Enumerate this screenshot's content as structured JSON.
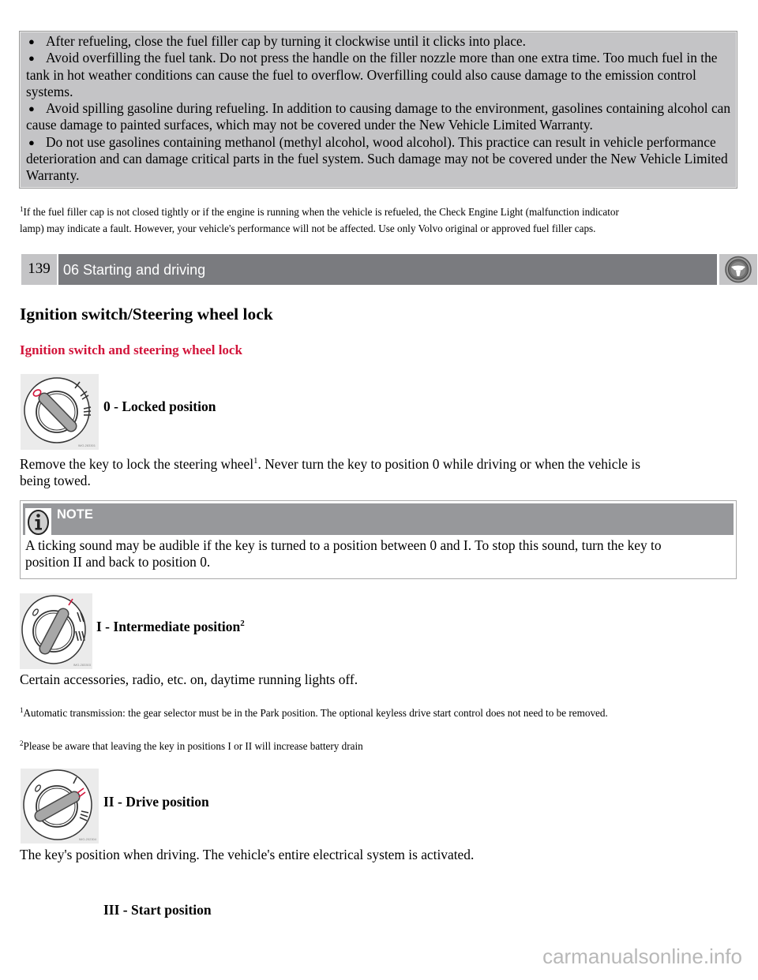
{
  "warning_box": {
    "bullets": [
      "After refueling, close the fuel filler cap by turning it clockwise until it clicks into place.",
      "Avoid overfilling the fuel tank. Do not press the handle on the filler nozzle more than one extra time. Too much fuel in the tank in hot weather conditions can cause the fuel to overflow. Overfilling could also cause damage to the emission control systems.",
      "Avoid spilling gasoline during refueling. In addition to causing damage to the environment, gasolines containing alcohol can cause damage to painted surfaces, which may not be covered under the New Vehicle Limited Warranty.",
      "Do not use gasolines containing methanol (methyl alcohol, wood alcohol). This practice can result in vehicle performance deterioration and can damage critical parts in the fuel system. Such damage may not be covered under the New Vehicle Limited Warranty."
    ]
  },
  "footnote_top": {
    "marker": "1",
    "line1": "If the fuel filler cap is not closed tightly or if the engine is running when the vehicle is refueled, the Check Engine Light (malfunction indicator",
    "line2": "lamp) may indicate a fault. However, your vehicle's performance will not be affected. Use only Volvo original or approved fuel filler caps."
  },
  "chapter": {
    "page_number": "139",
    "title": "06 Starting and driving",
    "icon": "steering-wheel-icon"
  },
  "page_title": "Ignition switch/Steering wheel lock",
  "section_title": "Ignition switch and steering wheel lock",
  "colors": {
    "section_title": "#d2143a",
    "chapter_bar": "#7a7b7f",
    "warning_bg": "#c4c4c6",
    "note_header": "#97989b"
  },
  "positions": [
    {
      "label": "0 - Locked position",
      "image_caption": "IMG-283301",
      "text_before_sup": "Remove the key to lock the steering wheel",
      "sup": "1",
      "text_after_sup_line1": ". Never turn the key to position 0 while driving or when the vehicle is",
      "text_line2": "being towed."
    },
    {
      "label": "I - Intermediate position",
      "label_sup": "2",
      "image_caption": "IMG-283303",
      "text": "Certain accessories, radio, etc. on, daytime running lights off."
    },
    {
      "label": "II - Drive position",
      "image_caption": "IMG-202304",
      "text": "The key's position when driving. The vehicle's entire electrical system is activated."
    },
    {
      "label": "III - Start position"
    }
  ],
  "note": {
    "label": "NOTE",
    "icon": "info-icon",
    "line1": "A ticking sound may be audible if the key is turned to a position between 0 and I. To stop this sound, turn the key to",
    "line2": "position II and back to position 0."
  },
  "footnotes": [
    {
      "marker": "1",
      "text": "Automatic transmission: the gear selector must be in the Park position. The optional keyless drive start control does not need to be removed."
    },
    {
      "marker": "2",
      "text": "Please be aware that leaving the key in positions I or II will increase battery drain"
    }
  ],
  "watermark": "carmanualsonline.info"
}
